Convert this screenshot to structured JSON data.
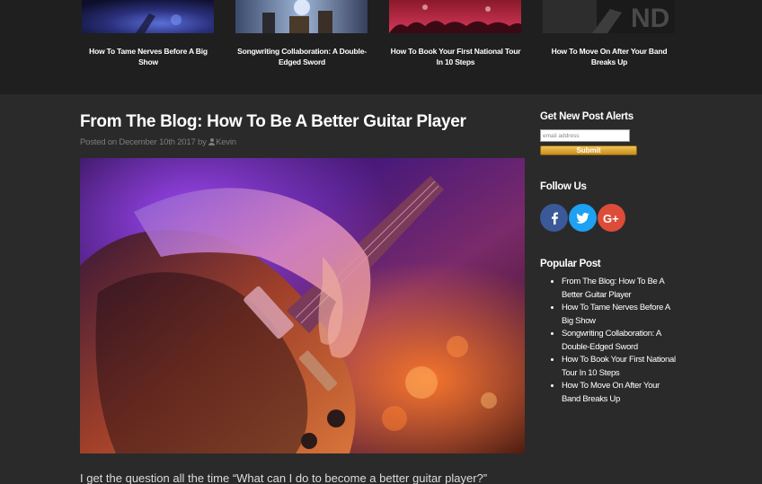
{
  "related_posts": [
    {
      "title": "How To Tame Nerves Before A Big Show",
      "thumb_icon": "concert-thumbnail-icon"
    },
    {
      "title": "Songwriting Collaboration: A Double-Edged Sword",
      "thumb_icon": "band-thumbnail-icon"
    },
    {
      "title": "How To Book Your First National Tour In 10 Steps",
      "thumb_icon": "crowd-thumbnail-icon"
    },
    {
      "title": "How To Move On After Your Band Breaks Up",
      "thumb_icon": "guitarist-thumbnail-icon"
    }
  ],
  "post": {
    "title": "From The Blog: How To Be A Better Guitar Player",
    "posted_on": "Posted on December 10th 2017 by",
    "author": "Kevin",
    "excerpt": "I get the question all the time “What can I do to become a better guitar player?”",
    "image_icon": "guitar-photo"
  },
  "sidebar": {
    "alerts_title": "Get New Post Alerts",
    "email_placeholder": "email address",
    "submit_label": "Submit",
    "follow_title": "Follow Us",
    "social": [
      {
        "name": "facebook",
        "glyph": "f",
        "color": "#3b5998"
      },
      {
        "name": "twitter",
        "glyph": "t",
        "color": "#1da1f2"
      },
      {
        "name": "google-plus",
        "glyph": "G+",
        "color": "#dd4b39"
      }
    ],
    "popular_title": "Popular Post",
    "popular_posts": [
      "From The Blog: How To Be A Better Guitar Player",
      "How To Tame Nerves Before A Big Show",
      "Songwriting Collaboration: A Double-Edged Sword",
      "How To Book Your First National Tour In 10 Steps",
      "How To Move On After Your Band Breaks Up"
    ]
  },
  "colors": {
    "page_bg": "#2a2a2a",
    "strip_bg": "#1f1f1f",
    "submit_gold": "#d9a030"
  }
}
